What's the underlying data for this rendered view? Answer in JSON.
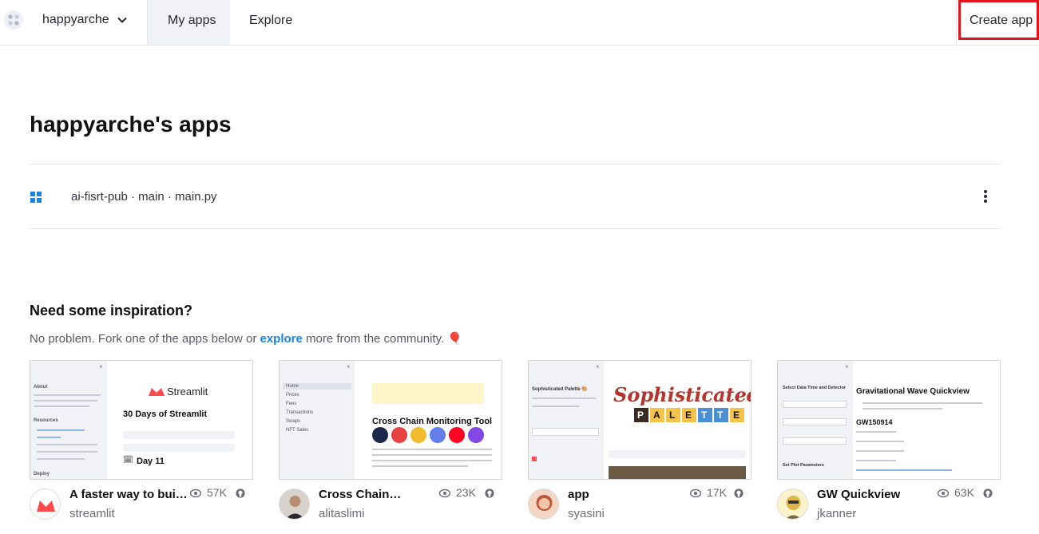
{
  "header": {
    "workspace": "happyarche",
    "nav": {
      "my_apps": "My apps",
      "explore": "Explore"
    },
    "create_app": "Create app"
  },
  "page_title": "happyarche's apps",
  "apps": [
    {
      "label": "ai-fisrt-pub · main · main.py"
    }
  ],
  "inspiration": {
    "title": "Need some inspiration?",
    "sub_before": "No problem. Fork one of the apps below or ",
    "sub_link": "explore",
    "sub_after": " more from the community. 🎈"
  },
  "cards": [
    {
      "title": "A faster way to bui…",
      "author": "streamlit",
      "views": "57K",
      "preview": {
        "sidebar_about": "About",
        "sidebar_resources": "Resources",
        "sidebar_deploy": "Deploy",
        "brand": "Streamlit",
        "heading": "30 Days of Streamlit",
        "day": "Day 11"
      }
    },
    {
      "title": "Cross Chain…",
      "author": "alitaslimi",
      "views": "23K",
      "preview": {
        "nav": [
          "Home",
          "Prices",
          "Fees",
          "Transactions",
          "Swaps",
          "NFT Sales"
        ],
        "heading": "Cross Chain Monitoring Tool"
      }
    },
    {
      "title": "app",
      "author": "syasini",
      "views": "17K",
      "preview": {
        "side_title": "Sophisticated Palette 🎨",
        "big1": "Sophisticated",
        "letters": [
          "P",
          "A",
          "L",
          "E",
          "T",
          "T",
          "E"
        ]
      }
    },
    {
      "title": "GW Quickview",
      "author": "jkanner",
      "views": "63K",
      "preview": {
        "side_title": "Select Data Time and Detector",
        "side_sub": "Set Plot Parameters",
        "heading": "Gravitational Wave Quickview",
        "event": "GW150914"
      }
    }
  ],
  "colors": {
    "accent": "#1c83e1",
    "highlight": "#e3121b",
    "brand_red": "#ff4b4b"
  }
}
